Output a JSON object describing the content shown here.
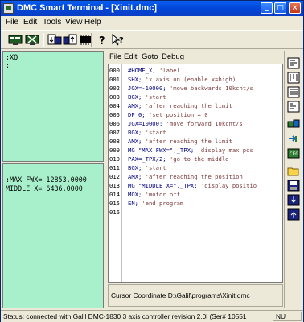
{
  "window": {
    "title": "DMC Smart Terminal - [Xinit.dmc]",
    "minimize_label": "_",
    "maximize_label": "□",
    "close_label": "×"
  },
  "menubar": {
    "items": [
      "File",
      "Edit",
      "Tools",
      "View",
      "Help"
    ]
  },
  "toolbar": {
    "icons": [
      "terminal-connect-icon",
      "terminal-disconnect-icon",
      "download-icon",
      "upload-icon",
      "memory-icon",
      "help-icon",
      "context-help-icon"
    ]
  },
  "terminal_top": {
    "lines": [
      ":XQ",
      ":"
    ]
  },
  "terminal_bottom": {
    "lines": [
      ":MAX FWX= 12853.0000",
      "MIDDLE X= 6436.0000"
    ]
  },
  "editor": {
    "menu": [
      "File",
      "Edit",
      "Goto",
      "Debug"
    ],
    "lines": [
      {
        "num": "000",
        "code": "#HOME_X;",
        "comment": "'label"
      },
      {
        "num": "001",
        "code": "SHX;",
        "comment": "'x axis on (enable x=high)"
      },
      {
        "num": "002",
        "code": "JGX=-10000;",
        "comment": "'move backwards 10kcnt/s"
      },
      {
        "num": "003",
        "code": "BGX;",
        "comment": "'start"
      },
      {
        "num": "004",
        "code": "AMX;",
        "comment": "'after reaching the limit"
      },
      {
        "num": "005",
        "code": "DP 0;",
        "comment": "'set position = 0"
      },
      {
        "num": "006",
        "code": "JGX=10000;",
        "comment": "'move forward 10kcnt/s"
      },
      {
        "num": "007",
        "code": "BGX;",
        "comment": "'start"
      },
      {
        "num": "008",
        "code": "AMX;",
        "comment": "'after reaching the limit"
      },
      {
        "num": "009",
        "code": "MG \"MAX FWX=\",_TPX;",
        "comment": "'display max pos"
      },
      {
        "num": "010",
        "code": "PAX=_TPX/2;",
        "comment": "'go to the middle"
      },
      {
        "num": "011",
        "code": "BGX;",
        "comment": "'start"
      },
      {
        "num": "012",
        "code": "AMX;",
        "comment": "'after reaching the position"
      },
      {
        "num": "013",
        "code": "MG \"MIDDLE X=\",_TPX;",
        "comment": "'display positio"
      },
      {
        "num": "014",
        "code": "MOX;",
        "comment": "'motor off"
      },
      {
        "num": "015",
        "code": "EN;",
        "comment": "'end program"
      },
      {
        "num": "016",
        "code": "",
        "comment": ""
      }
    ],
    "cursor_coordinate_label": "Cursor Coordinate",
    "file_path": "D:\\Galil\\programs\\Xinit.dmc"
  },
  "side_toolbar": {
    "icons": [
      "align-left-icon",
      "align-top-icon",
      "align-list-icon",
      "list-icon",
      "motion-icon",
      "send-icon",
      "gear-icon",
      "open-folder-icon",
      "save-icon",
      "download-file-icon",
      "upload-file-icon"
    ]
  },
  "statusbar": {
    "text": "Status: connected with Galil DMC-1830 3 axis controller revision 2.0l (Ser# 10551",
    "indicator": "NU"
  },
  "colors": {
    "terminal_bg": "#a8f0cc",
    "titlebar": "#0046d8",
    "code_text": "#000080"
  }
}
